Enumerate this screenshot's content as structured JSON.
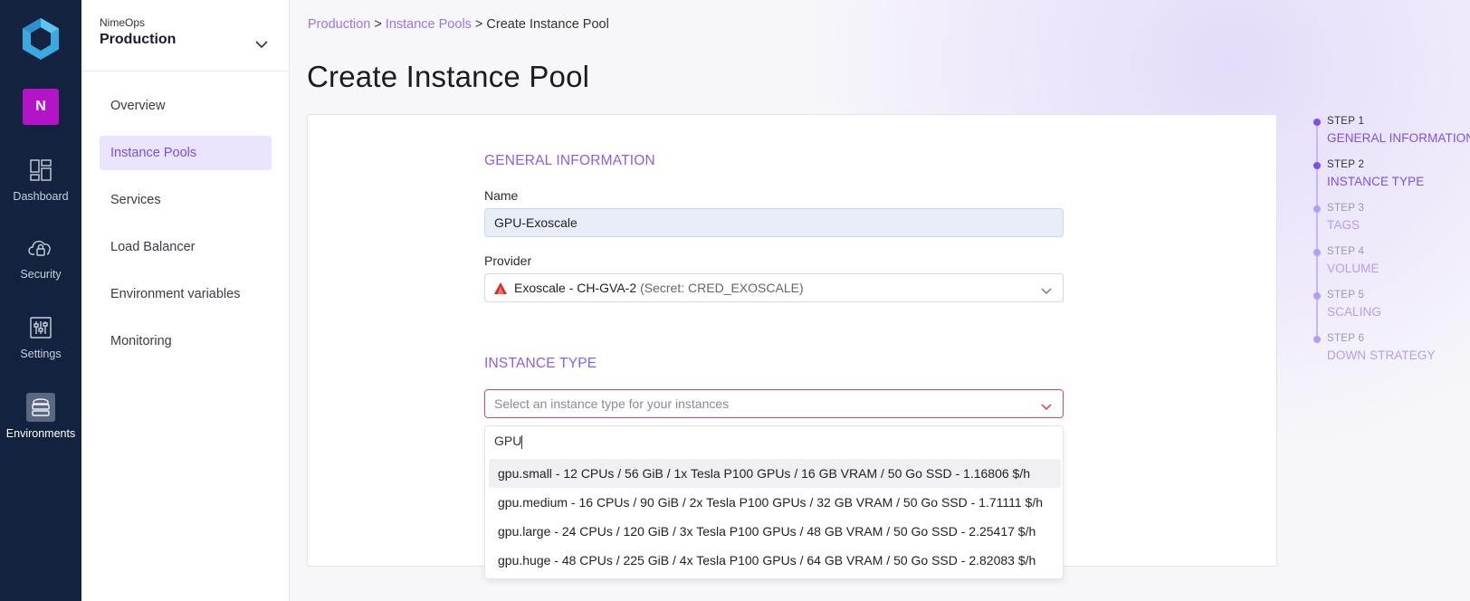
{
  "rail": {
    "avatar_initial": "N",
    "items": [
      {
        "label": "Dashboard",
        "icon": "dashboard-icon"
      },
      {
        "label": "Security",
        "icon": "cloud-lock-icon"
      },
      {
        "label": "Settings",
        "icon": "sliders-icon"
      },
      {
        "label": "Environments",
        "icon": "server-stack-icon",
        "active": true
      }
    ]
  },
  "sidebar": {
    "org": "NimeOps",
    "environment": "Production",
    "items": [
      {
        "label": "Overview"
      },
      {
        "label": "Instance Pools",
        "active": true
      },
      {
        "label": "Services"
      },
      {
        "label": "Load Balancer"
      },
      {
        "label": "Environment variables"
      },
      {
        "label": "Monitoring"
      }
    ]
  },
  "breadcrumb": {
    "items": [
      "Production",
      "Instance Pools",
      "Create Instance Pool"
    ],
    "separator": ">"
  },
  "page_title": "Create Instance Pool",
  "form": {
    "general": {
      "title": "GENERAL INFORMATION",
      "name_label": "Name",
      "name_value": "GPU-Exoscale",
      "provider_label": "Provider",
      "provider_value": "Exoscale - CH-GVA-2",
      "provider_secret": "(Secret: CRED_EXOSCALE)"
    },
    "instance_type": {
      "title": "INSTANCE TYPE",
      "placeholder": "Select an instance type for your instances",
      "search_value": "GPU",
      "options": [
        "gpu.small - 12 CPUs / 56 GiB / 1x Tesla P100 GPUs / 16 GB VRAM / 50 Go SSD - 1.16806 $/h",
        "gpu.medium - 16 CPUs / 90 GiB / 2x Tesla P100 GPUs / 32 GB VRAM / 50 Go SSD - 1.71111 $/h",
        "gpu.large - 24 CPUs / 120 GiB / 3x Tesla P100 GPUs / 48 GB VRAM / 50 Go SSD - 2.25417 $/h",
        "gpu.huge - 48 CPUs / 225 GiB / 4x Tesla P100 GPUs / 64 GB VRAM / 50 Go SSD - 2.82083 $/h"
      ]
    }
  },
  "steps": [
    {
      "num": "STEP 1",
      "name": "GENERAL INFORMATION",
      "done": true
    },
    {
      "num": "STEP 2",
      "name": "INSTANCE TYPE",
      "done": true
    },
    {
      "num": "STEP 3",
      "name": "TAGS",
      "done": false
    },
    {
      "num": "STEP 4",
      "name": "VOLUME",
      "done": false
    },
    {
      "num": "STEP 5",
      "name": "SCALING",
      "done": false
    },
    {
      "num": "STEP 6",
      "name": "DOWN STRATEGY",
      "done": false
    }
  ],
  "colors": {
    "rail_bg": "#13233f",
    "accent": "#7b4ff0",
    "avatar": "#b414c8",
    "error_border": "#e0475f",
    "exoscale_red": "#da291c"
  }
}
